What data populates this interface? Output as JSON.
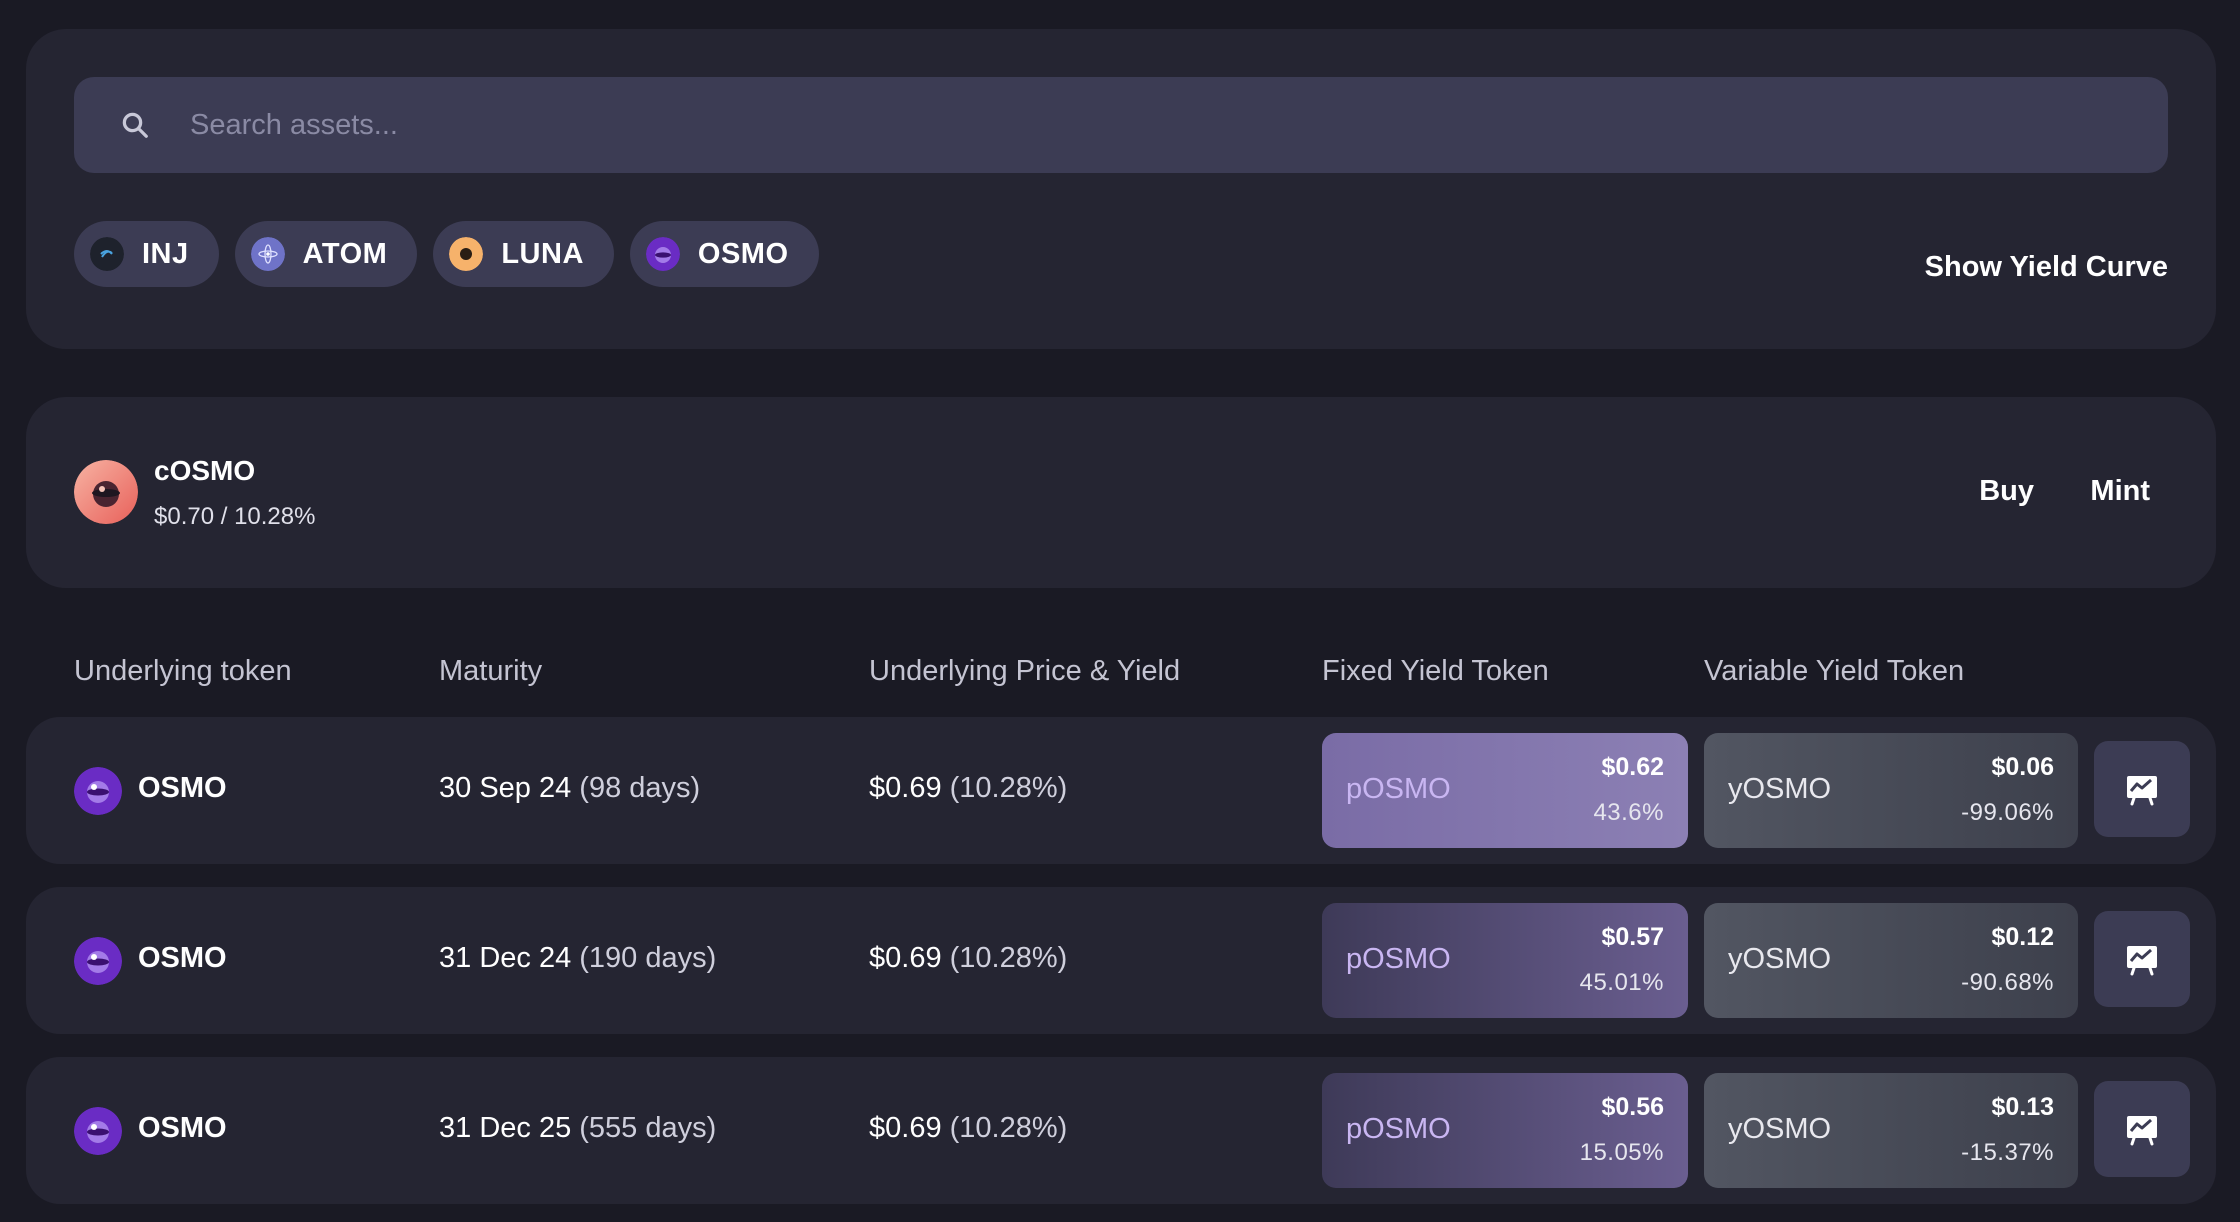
{
  "search": {
    "placeholder": "Search assets..."
  },
  "chips": [
    {
      "label": "INJ",
      "color": "#2b2f3a"
    },
    {
      "label": "ATOM",
      "color": "#6f73c8"
    },
    {
      "label": "LUNA",
      "color": "#f6b26b"
    },
    {
      "label": "OSMO",
      "color": "#7b2fd1"
    }
  ],
  "show_yield_curve_label": "Show Yield Curve",
  "asset": {
    "name": "cOSMO",
    "price_yield": "$0.70 / 10.28%",
    "buy_label": "Buy",
    "mint_label": "Mint"
  },
  "table": {
    "headers": {
      "underlying": "Underlying token",
      "maturity": "Maturity",
      "price_yield": "Underlying Price & Yield",
      "fixed": "Fixed Yield Token",
      "variable": "Variable Yield Token"
    },
    "rows": [
      {
        "token": "OSMO",
        "maturity_date": "30 Sep 24",
        "maturity_days": "(98 days)",
        "price": "$0.69",
        "yield": "(10.28%)",
        "fixed": {
          "name": "pOSMO",
          "price": "$0.62",
          "pct": "43.6%"
        },
        "variable": {
          "name": "yOSMO",
          "price": "$0.06",
          "pct": "-99.06%"
        }
      },
      {
        "token": "OSMO",
        "maturity_date": "31 Dec 24",
        "maturity_days": "(190 days)",
        "price": "$0.69",
        "yield": "(10.28%)",
        "fixed": {
          "name": "pOSMO",
          "price": "$0.57",
          "pct": "45.01%"
        },
        "variable": {
          "name": "yOSMO",
          "price": "$0.12",
          "pct": "-90.68%"
        }
      },
      {
        "token": "OSMO",
        "maturity_date": "31 Dec 25",
        "maturity_days": "(555 days)",
        "price": "$0.69",
        "yield": "(10.28%)",
        "fixed": {
          "name": "pOSMO",
          "price": "$0.56",
          "pct": "15.05%"
        },
        "variable": {
          "name": "yOSMO",
          "price": "$0.13",
          "pct": "-15.37%"
        }
      }
    ]
  },
  "colors": {
    "fixed_highlight": "#7a6ca6",
    "fixed_normal": "#5a4f7e",
    "variable": "#4a4e5a"
  }
}
